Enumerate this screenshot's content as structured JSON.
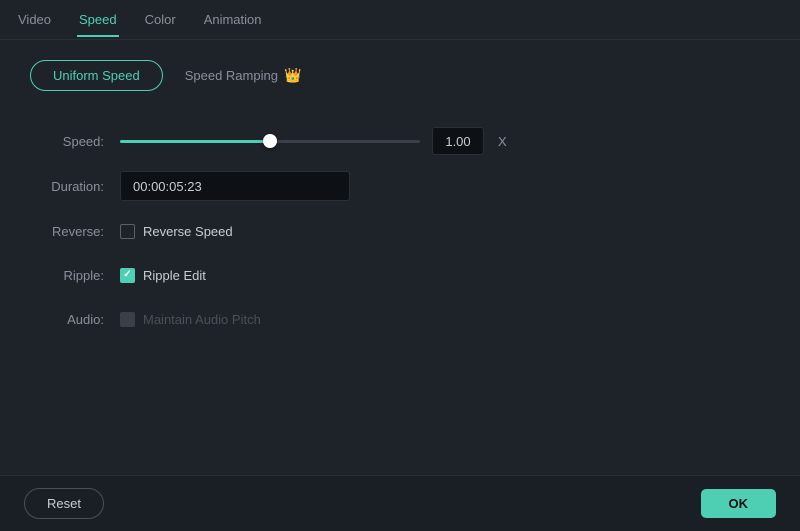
{
  "nav": {
    "tabs": [
      {
        "id": "video",
        "label": "Video",
        "active": false
      },
      {
        "id": "speed",
        "label": "Speed",
        "active": true
      },
      {
        "id": "color",
        "label": "Color",
        "active": false
      },
      {
        "id": "animation",
        "label": "Animation",
        "active": false
      }
    ]
  },
  "modes": {
    "uniform": {
      "label": "Uniform Speed",
      "active": true
    },
    "ramp": {
      "label": "Speed Ramping",
      "active": false,
      "crown": "👑"
    }
  },
  "form": {
    "speed": {
      "label": "Speed:",
      "value": "1.00",
      "unit": "X",
      "slider_percent": 50
    },
    "duration": {
      "label": "Duration:",
      "value": "00:00:05:23"
    },
    "reverse": {
      "label": "Reverse:",
      "checkbox_label": "Reverse Speed",
      "checked": false
    },
    "ripple": {
      "label": "Ripple:",
      "checkbox_label": "Ripple Edit",
      "checked": true
    },
    "audio": {
      "label": "Audio:",
      "checkbox_label": "Maintain Audio Pitch",
      "checked": false,
      "disabled": true
    }
  },
  "footer": {
    "reset_label": "Reset",
    "ok_label": "OK"
  }
}
